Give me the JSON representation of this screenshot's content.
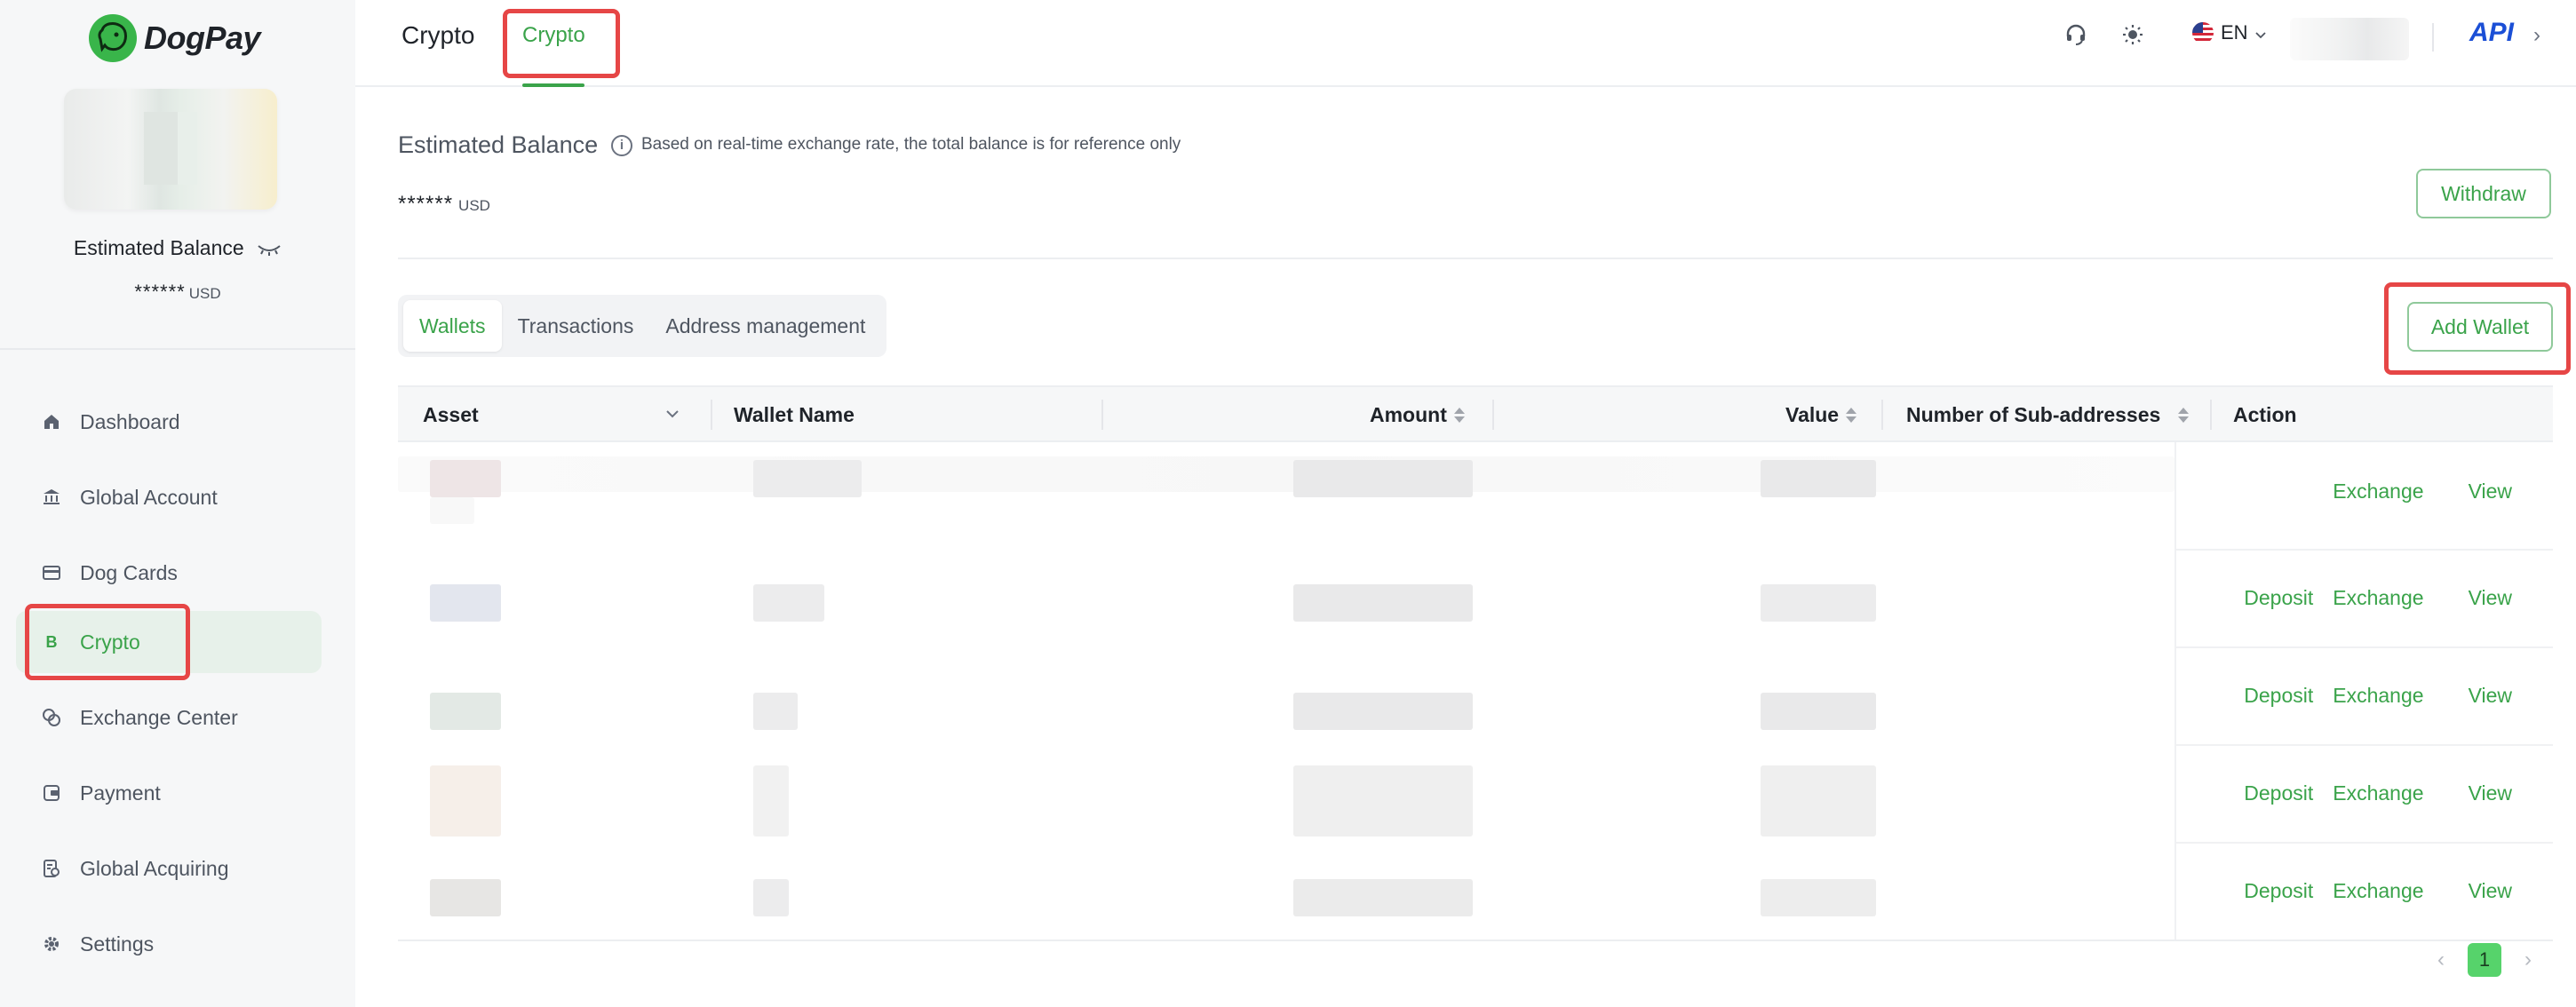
{
  "brand": {
    "name": "DogPay",
    "accent": "#3aa34a"
  },
  "sidebar": {
    "balance_label": "Estimated Balance",
    "balance_value": "******",
    "balance_unit": "USD",
    "items": [
      {
        "label": "Dashboard",
        "icon": "home-icon"
      },
      {
        "label": "Global Account",
        "icon": "bank-icon"
      },
      {
        "label": "Dog Cards",
        "icon": "card-icon"
      },
      {
        "label": "Crypto",
        "icon": "crypto-icon",
        "glyph": "B",
        "active": true
      },
      {
        "label": "Exchange Center",
        "icon": "exchange-icon"
      },
      {
        "label": "Payment",
        "icon": "wallet-icon"
      },
      {
        "label": "Global Acquiring",
        "icon": "acquiring-icon"
      },
      {
        "label": "Settings",
        "icon": "gear-icon"
      }
    ]
  },
  "header": {
    "title": "Crypto",
    "tab": "Crypto",
    "language": "EN",
    "api_label": "API",
    "chevron": "›"
  },
  "summary": {
    "title": "Estimated Balance",
    "info_glyph": "i",
    "note": "Based on real-time exchange rate, the total balance is for reference only",
    "value": "******",
    "unit": "USD",
    "withdraw_label": "Withdraw"
  },
  "tabs": [
    {
      "label": "Wallets",
      "active": true
    },
    {
      "label": "Transactions"
    },
    {
      "label": "Address management"
    }
  ],
  "add_wallet_label": "Add Wallet",
  "table": {
    "columns": [
      "Asset",
      "Wallet Name",
      "Amount",
      "Value",
      "Number of Sub-addresses",
      "Action"
    ],
    "actions": {
      "deposit": "Deposit",
      "exchange": "Exchange",
      "view": "View"
    },
    "rows": [
      {
        "actions": [
          "exchange",
          "view"
        ]
      },
      {
        "actions": [
          "deposit",
          "exchange",
          "view"
        ]
      },
      {
        "actions": [
          "deposit",
          "exchange",
          "view"
        ]
      },
      {
        "actions": [
          "deposit",
          "exchange",
          "view"
        ]
      },
      {
        "actions": [
          "deposit",
          "exchange",
          "view"
        ]
      }
    ]
  },
  "pagination": {
    "current": "1",
    "prev": "‹",
    "next": "›"
  }
}
